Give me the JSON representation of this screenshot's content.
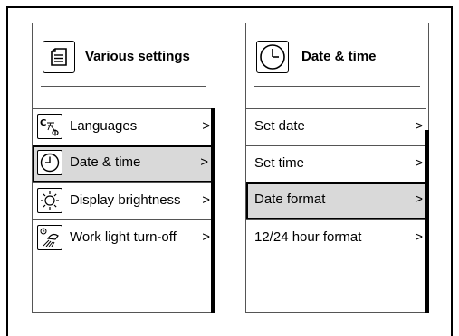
{
  "left_panel": {
    "title": "Various settings",
    "header_icon": "document-icon",
    "items": [
      {
        "label": "Languages",
        "icon": "language-icon",
        "chevron": ">",
        "selected": false
      },
      {
        "label": "Date & time",
        "icon": "clock-icon",
        "chevron": ">",
        "selected": true
      },
      {
        "label": "Display brightness",
        "icon": "sun-icon",
        "chevron": ">",
        "selected": false
      },
      {
        "label": "Work light turn-off",
        "icon": "work-light-icon",
        "chevron": ">",
        "selected": false
      }
    ]
  },
  "right_panel": {
    "title": "Date & time",
    "header_icon": "clock-icon",
    "items": [
      {
        "label": "Set date",
        "chevron": ">",
        "selected": false
      },
      {
        "label": "Set time",
        "chevron": ">",
        "selected": false
      },
      {
        "label": "Date format",
        "chevron": ">",
        "selected": true
      },
      {
        "label": "12/24 hour format",
        "chevron": ">",
        "selected": false
      }
    ]
  },
  "colors": {
    "selected_bg": "#d9d9d9",
    "border": "#555555",
    "scrollbar": "#000000"
  }
}
